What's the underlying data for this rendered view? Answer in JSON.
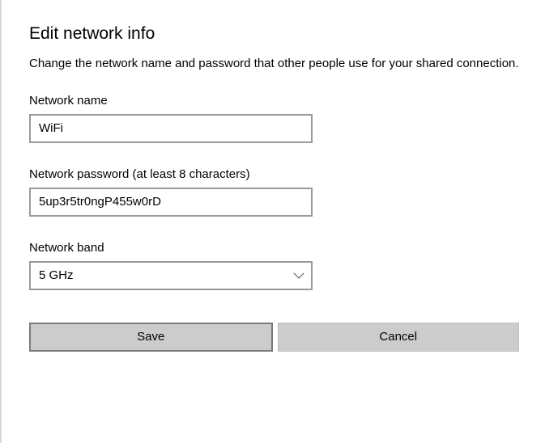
{
  "title": "Edit network info",
  "description": "Change the network name and password that other people use for your shared connection.",
  "fields": {
    "networkName": {
      "label": "Network name",
      "value": "WiFi"
    },
    "networkPassword": {
      "label": "Network password (at least 8 characters)",
      "value": "5up3r5tr0ngP455w0rD"
    },
    "networkBand": {
      "label": "Network band",
      "value": "5 GHz"
    }
  },
  "buttons": {
    "save": "Save",
    "cancel": "Cancel"
  }
}
